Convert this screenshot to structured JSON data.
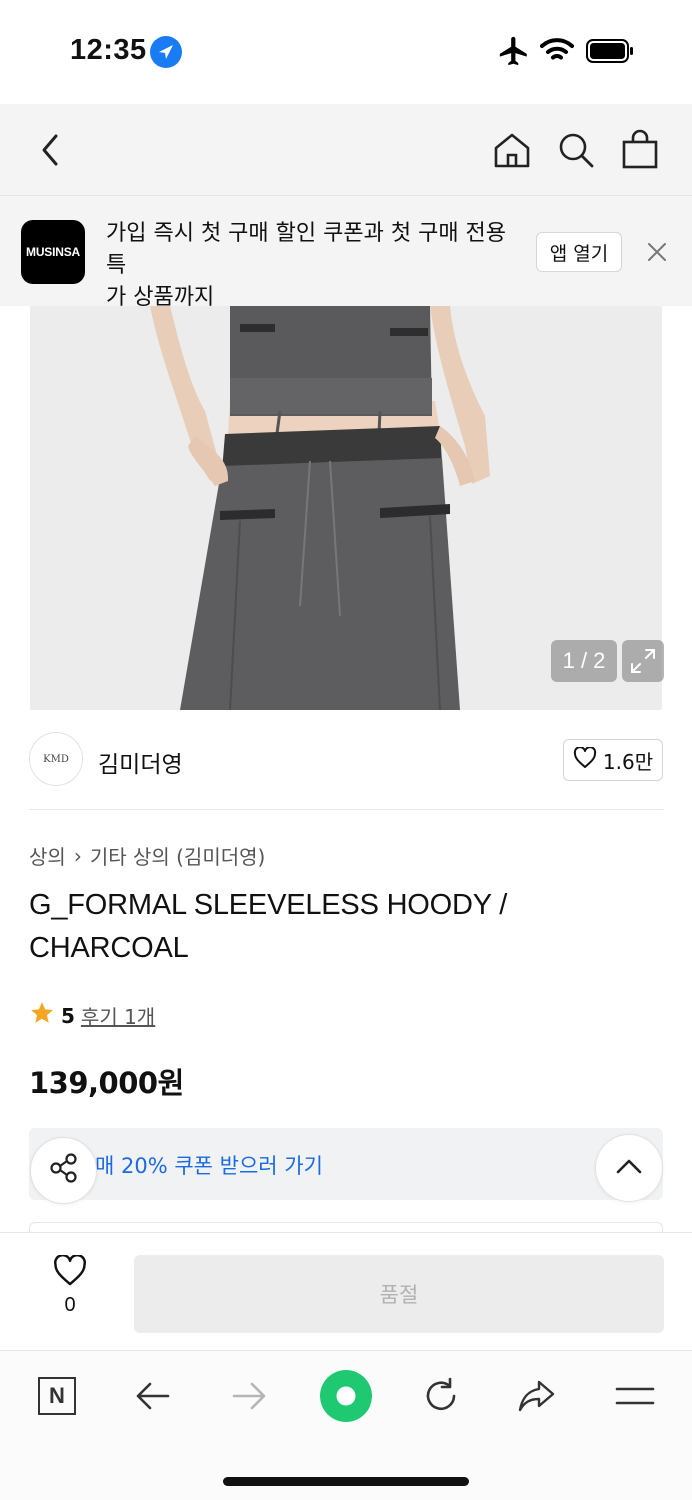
{
  "status_bar": {
    "time": "12:35",
    "icons": [
      "location-arrow-icon",
      "airplane-icon",
      "wifi-icon",
      "battery-icon"
    ]
  },
  "header": {
    "icons": [
      "back-arrow-icon",
      "home-icon",
      "search-icon",
      "shopping-bag-icon"
    ]
  },
  "app_banner": {
    "logo_text": "MUSINSA",
    "message_line1": "가입 즉시 첫 구매 할인 쿠폰과 첫 구매 전용 특",
    "message_line2": "가 상품까지",
    "open_app_label": "앱 열기",
    "close_icon": "close-icon"
  },
  "gallery": {
    "counter": "1 / 2",
    "expand_icon": "expand-icon"
  },
  "brand": {
    "name": "김미더영",
    "logo_text": "KMD",
    "likes": "1.6만"
  },
  "breadcrumb": {
    "category": "상의",
    "separator": "›",
    "subcategory": "기타 상의 (김미더영)"
  },
  "product": {
    "title": "G_FORMAL SLEEVELESS HOODY / CHARCOAL",
    "rating": "5",
    "reviews_label": "후기 1개",
    "price": "139,000원"
  },
  "coupon": {
    "text": "매 20% 쿠폰 받으러 가기"
  },
  "purchase_bar": {
    "wish_count": "0",
    "status_label": "품절"
  },
  "browser_toolbar": {
    "icons": [
      "naver-n-icon",
      "back-icon",
      "forward-icon",
      "green-dot-icon",
      "reload-icon",
      "share-icon",
      "menu-icon"
    ]
  },
  "colors": {
    "accent_blue": "#1b6ae0",
    "star": "#f5a623",
    "green": "#1ec971",
    "location_blue": "#1a7cf5"
  }
}
